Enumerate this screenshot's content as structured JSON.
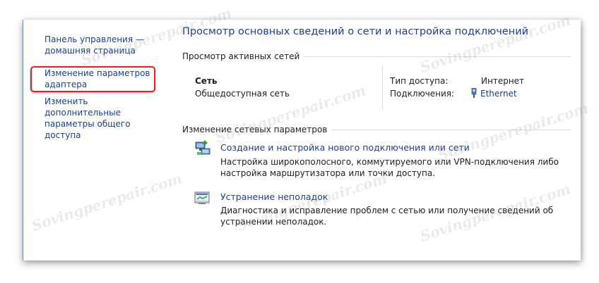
{
  "sidebar": {
    "items": [
      {
        "line1": "Панель управления —",
        "line2": "домашняя страница"
      },
      {
        "line1": "Изменение параметров",
        "line2": "адаптера"
      },
      {
        "line1": "Изменить дополнительные",
        "line2": "параметры общего доступа"
      }
    ]
  },
  "main": {
    "title": "Просмотр основных сведений о сети и настройка подключений",
    "active_networks": {
      "header": "Просмотр активных сетей",
      "network_name": "Сеть",
      "network_type": "Общедоступная сеть",
      "access_type_label": "Тип доступа:",
      "access_type_value": "Интернет",
      "connections_label": "Подключения:",
      "connections_value": "Ethernet"
    },
    "change_settings": {
      "header": "Изменение сетевых параметров",
      "tasks": [
        {
          "title": "Создание и настройка нового подключения или сети",
          "desc": "Настройка широкополосного, коммутируемого или VPN-подключения либо настройка маршрутизатора или точки доступа.",
          "icon": "new-connection-icon"
        },
        {
          "title": "Устранение неполадок",
          "desc": "Диагностика и исправление проблем с сетью или получение сведений об устранении неполадок.",
          "icon": "troubleshoot-icon"
        }
      ]
    }
  },
  "watermark": "Sovingperepair.com",
  "colors": {
    "link": "#1b3f8b",
    "highlight": "#d9262c",
    "title": "#1e3e8e"
  }
}
